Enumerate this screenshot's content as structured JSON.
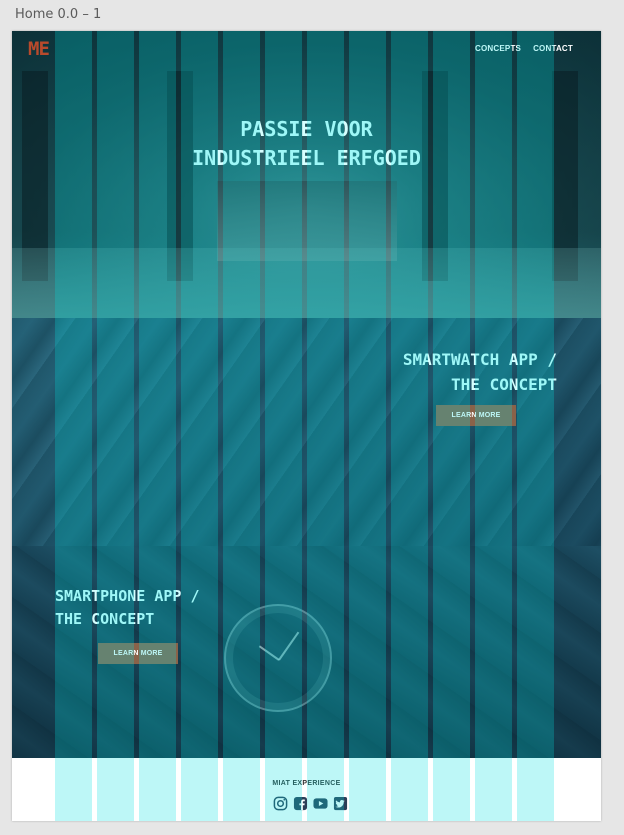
{
  "artboard_label": "Home 0.0 – 1",
  "nav": {
    "logo": "ME",
    "links": [
      "CONCEPTS",
      "CONTACT"
    ]
  },
  "hero": {
    "title_line1": "PASSIE VOOR",
    "title_line2": "INDUSTRIEEL ERFGOED"
  },
  "smartwatch": {
    "title_line1": "SMARTWATCH APP /",
    "title_line2": "THE CONCEPT",
    "button": "LEARN MORE"
  },
  "smartphone": {
    "title_line1": "SMARTPHONE APP /",
    "title_line2": "THE CONCEPT",
    "button": "LEARN MORE"
  },
  "footer": {
    "title": "MIAT EXPERIENCE",
    "socials": [
      "instagram-icon",
      "facebook-icon",
      "youtube-icon",
      "twitter-icon"
    ]
  },
  "colors": {
    "accent_button": "#8a6249",
    "logo": "#b84a2c",
    "heading": "#d6ffff",
    "grid_overlay": "#00e1e1"
  }
}
